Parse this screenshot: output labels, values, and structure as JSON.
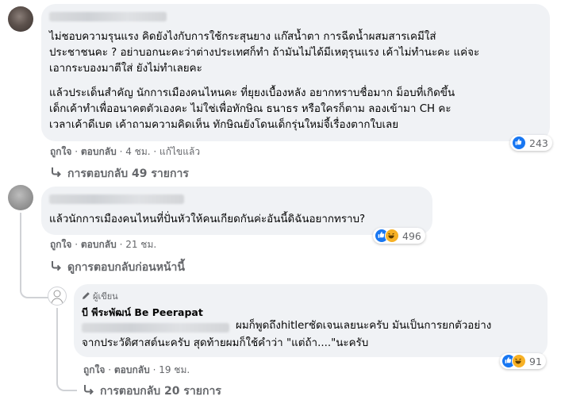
{
  "comment1": {
    "paragraph1": [
      "ไม่ชอบความรุนแรง คิดยังไงกับการใช้กระสุนยาง แก๊สน้ำตา การฉีดน้ำผสมสารเคมีใส่",
      "ประชาชนคะ ? อย่าบอกนะคะว่าต่างประเทศก็ทำ ถ้ามันไม่ได้มีเหตุรุนแรง เค้าไม่ทำนะคะ แค่จะ",
      "เอากระบองมาตีใส่ ยังไม่ทำเลยคะ"
    ],
    "paragraph2": [
      "แล้วประเด็นสำคัญ นักการเมืองคนไหนคะ ที่ยุยงเบื้องหลัง อยากทราบชื่อมาก ม็อบที่เกิดขึ้น",
      "เด็กเค้าทำเพื่ออนาคตตัวเองคะ ไม่ใช่เพื่อทักษิณ ธนาธร หรือใครก็ตาม ลองเข้ามา CH คะ",
      "เวลาเค้าดีเบต เค้าถามความคิดเห็น ทักษิณยังโดนเด็กรุ่นใหม่จี้เรื่องตากใบเลย"
    ],
    "like_label": "ถูกใจ",
    "reply_label": "ตอบกลับ",
    "time": "4 ชม.",
    "edited": "แก้ไขแล้ว",
    "reactions_count": "243",
    "view_replies": "การตอบกลับ 49 รายการ"
  },
  "comment2": {
    "text": "แล้วนักการเมืองคนไหนที่ปั่นหัวให้คนเกียดกันค่ะอันนี้ดิฉันอยากทราบ?",
    "like_label": "ถูกใจ",
    "reply_label": "ตอบกลับ",
    "time": "21 ชม.",
    "reactions_count": "496",
    "previous_replies": "ดูการตอบกลับก่อนหน้านี้"
  },
  "reply1": {
    "author_badge": "ผู้เขียน",
    "author_name": "บี พีระพัฒน์ Be Peerapat",
    "line1": "ผมก็พูดถึงhitlerชัดเจนเลยนะครับ มันเป็นการยกตัวอย่าง",
    "line2": "จากประวัติศาสต์นะครับ สุดท้ายผมก็ใช้คำว่า \"แต่ถ้า....\"นะครับ",
    "like_label": "ถูกใจ",
    "reply_label": "ตอบกลับ",
    "time": "19 ชม.",
    "reactions_count": "91",
    "view_replies": "การตอบกลับ 20 รายการ"
  },
  "colors": {
    "bubble": "#f0f2f5",
    "secondary_text": "#65676b",
    "like_blue": "#1877f2",
    "haha_yellow": "#f7b125"
  }
}
